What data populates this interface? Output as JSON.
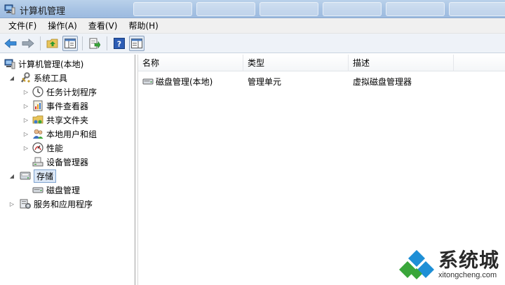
{
  "window": {
    "title": "计算机管理"
  },
  "menu": [
    "文件(F)",
    "操作(A)",
    "查看(V)",
    "帮助(H)"
  ],
  "toolbar": {
    "buttons": [
      "back-arrow-icon",
      "forward-arrow-icon",
      "up-folder-icon",
      "show-tree-icon",
      "export-list-icon",
      "help-icon",
      "action-pane-icon"
    ]
  },
  "tree": {
    "root": "计算机管理(本地)",
    "system_tools": "系统工具",
    "task_scheduler": "任务计划程序",
    "event_viewer": "事件查看器",
    "shared_folders": "共享文件夹",
    "local_users": "本地用户和组",
    "performance": "性能",
    "device_manager": "设备管理器",
    "storage": "存储",
    "disk_management": "磁盘管理",
    "services_apps": "服务和应用程序"
  },
  "list": {
    "columns": [
      "名称",
      "类型",
      "描述"
    ],
    "rows": [
      {
        "name": "磁盘管理(本地)",
        "type": "管理单元",
        "desc": "虚拟磁盘管理器"
      }
    ]
  },
  "watermark": {
    "brand": "系统城",
    "url": "xitongcheng.com"
  },
  "colors": {
    "accent_blue": "#1e8fd6",
    "accent_green": "#3aaa35",
    "selection": "#dce8f7"
  }
}
